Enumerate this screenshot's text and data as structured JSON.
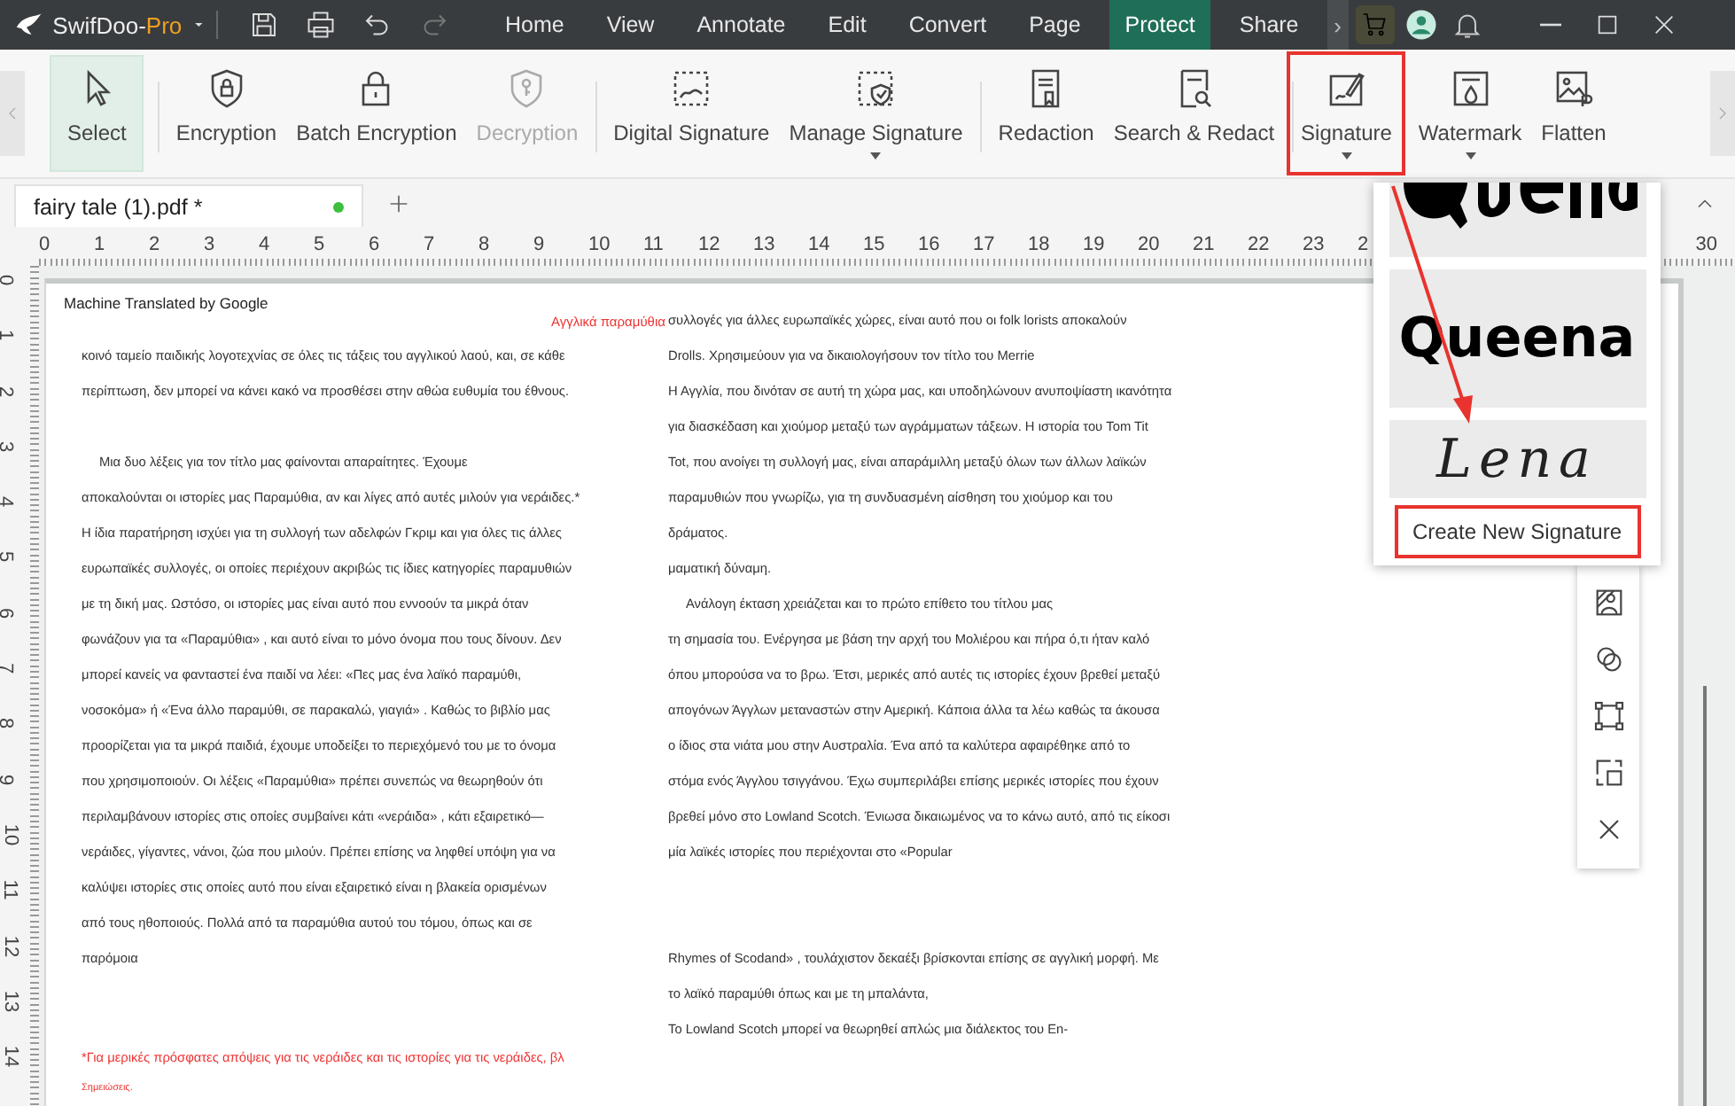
{
  "app": {
    "name": "SwifDoo-",
    "edition": "Pro"
  },
  "quick_actions": [
    {
      "kind": "save",
      "disabled": false
    },
    {
      "kind": "print",
      "disabled": false
    },
    {
      "kind": "undo",
      "disabled": false
    },
    {
      "kind": "redo",
      "disabled": true
    }
  ],
  "menu": [
    {
      "label": "Home",
      "selected": false
    },
    {
      "label": "View",
      "selected": false
    },
    {
      "label": "Annotate",
      "selected": false
    },
    {
      "label": "Edit",
      "selected": false
    },
    {
      "label": "Convert",
      "selected": false
    },
    {
      "label": "Page",
      "selected": false
    },
    {
      "label": "Protect",
      "selected": true
    },
    {
      "label": "Share",
      "selected": false
    }
  ],
  "menu_more": "›",
  "toolbar": [
    {
      "label": "Select",
      "selected": true,
      "disabled": false,
      "dropdown": false,
      "highlighted": false,
      "group_start": false
    },
    {
      "label": "Encryption",
      "selected": false,
      "disabled": false,
      "dropdown": false,
      "highlighted": false,
      "group_start": true
    },
    {
      "label": "Batch Encryption",
      "selected": false,
      "disabled": false,
      "dropdown": false,
      "highlighted": false,
      "group_start": false
    },
    {
      "label": "Decryption",
      "selected": false,
      "disabled": true,
      "dropdown": false,
      "highlighted": false,
      "group_start": false
    },
    {
      "label": "Digital Signature",
      "selected": false,
      "disabled": false,
      "dropdown": false,
      "highlighted": false,
      "group_start": true
    },
    {
      "label": "Manage Signature",
      "selected": false,
      "disabled": false,
      "dropdown": true,
      "highlighted": false,
      "group_start": false
    },
    {
      "label": "Redaction",
      "selected": false,
      "disabled": false,
      "dropdown": false,
      "highlighted": false,
      "group_start": true
    },
    {
      "label": "Search & Redact",
      "selected": false,
      "disabled": false,
      "dropdown": false,
      "highlighted": false,
      "group_start": false
    },
    {
      "label": "Signature",
      "selected": false,
      "disabled": false,
      "dropdown": true,
      "highlighted": true,
      "group_start": true
    },
    {
      "label": "Watermark",
      "selected": false,
      "disabled": false,
      "dropdown": true,
      "highlighted": false,
      "group_start": false
    },
    {
      "label": "Flatten",
      "selected": false,
      "disabled": false,
      "dropdown": false,
      "highlighted": false,
      "group_start": false
    }
  ],
  "tabs": [
    {
      "label": "fairy tale (1).pdf *",
      "selected": true,
      "modified": true
    }
  ],
  "ruler": {
    "labels": [
      "0",
      "1",
      "2",
      "3",
      "4",
      "5",
      "6",
      "7",
      "8",
      "9",
      "10",
      "11",
      "12",
      "13",
      "14",
      "15",
      "16",
      "17",
      "18",
      "19",
      "20",
      "21",
      "22",
      "23",
      "2"
    ],
    "end_label": "30",
    "vertical_labels": [
      "0",
      "1",
      "2",
      "3",
      "4",
      "5",
      "6",
      "7",
      "8",
      "9",
      "10",
      "11",
      "12",
      "13",
      "14"
    ]
  },
  "document": {
    "header": "Machine Translated by Google",
    "title": "Αγγλικά παραμύθια",
    "columns": [
      {
        "lines": [
          {
            "kind": "text",
            "space_before": false,
            "indent": false,
            "text": "κοινό ταμείο παιδικής λογοτεχνίας σε όλες τις τάξεις του αγγλικού λαού, και, σε κάθε"
          },
          {
            "kind": "text",
            "space_before": false,
            "indent": false,
            "text": "περίπτωση, δεν μπορεί να κάνει κακό να προσθέσει στην αθώα ευθυμία του έθνους."
          },
          {
            "kind": "text",
            "space_before": true,
            "indent": true,
            "text": "Μια δυο λέξεις για τον τίτλο μας φαίνονται απαραίτητες. Έχουμε"
          },
          {
            "kind": "text",
            "space_before": false,
            "indent": false,
            "text": "αποκαλούνται οι ιστορίες μας Παραμύθια, αν και λίγες από αυτές μιλούν για νεράιδες.*"
          },
          {
            "kind": "text",
            "space_before": false,
            "indent": false,
            "text": "Η ίδια παρατήρηση ισχύει για τη συλλογή των αδελφών Γκριμ και για όλες τις άλλες"
          },
          {
            "kind": "text",
            "space_before": false,
            "indent": false,
            "text": "ευρωπαϊκές συλλογές, οι οποίες περιέχουν ακριβώς τις ίδιες κατηγορίες παραμυθιών"
          },
          {
            "kind": "text",
            "space_before": false,
            "indent": false,
            "text": "με τη δική μας. Ωστόσο, οι ιστορίες μας είναι αυτό που εννοούν τα μικρά όταν"
          },
          {
            "kind": "text",
            "space_before": false,
            "indent": false,
            "text": "φωνάζουν για τα «Παραμύθια» , και αυτό είναι το μόνο όνομα που τους δίνουν. Δεν"
          },
          {
            "kind": "text",
            "space_before": false,
            "indent": false,
            "text": "μπορεί κανείς να φανταστεί ένα παιδί να λέει: «Πες μας ένα λαϊκό παραμύθι,"
          },
          {
            "kind": "text",
            "space_before": false,
            "indent": false,
            "text": "νοσοκόμα» ή «Ένα άλλο παραμύθι, σε παρακαλώ, γιαγιά» . Καθώς το βιβλίο μας"
          },
          {
            "kind": "text",
            "space_before": false,
            "indent": false,
            "text": "προορίζεται για τα μικρά παιδιά, έχουμε υποδείξει το περιεχόμενό του με το όνομα"
          },
          {
            "kind": "text",
            "space_before": false,
            "indent": false,
            "text": "που χρησιμοποιούν. Οι λέξεις «Παραμύθια» πρέπει συνεπώς να θεωρηθούν ότι"
          },
          {
            "kind": "text",
            "space_before": false,
            "indent": false,
            "text": "περιλαμβάνουν ιστορίες στις οποίες συμβαίνει κάτι «νεράιδα» , κάτι εξαιρετικό—"
          },
          {
            "kind": "text",
            "space_before": false,
            "indent": false,
            "text": "νεράιδες, γίγαντες, νάνοι, ζώα που μιλούν. Πρέπει επίσης να ληφθεί υπόψη για να"
          },
          {
            "kind": "text",
            "space_before": false,
            "indent": false,
            "text": "καλύψει ιστορίες στις οποίες αυτό που είναι εξαιρετικό είναι η βλακεία ορισμένων"
          },
          {
            "kind": "text",
            "space_before": false,
            "indent": false,
            "text": "από τους ηθοποιούς. Πολλά από τα παραμύθια αυτού του τόμου, όπως και σε"
          },
          {
            "kind": "text",
            "space_before": false,
            "indent": false,
            "text": "παρόμοια"
          },
          {
            "kind": "footnote",
            "space_before": true,
            "indent": false,
            "text": "*Για μερικές πρόσφατες απόψεις για τις νεράιδες και τις ιστορίες για τις νεράιδες, βλ"
          },
          {
            "kind": "note",
            "space_before": false,
            "indent": false,
            "text": "Σημειώσεις."
          }
        ]
      },
      {
        "lines": [
          {
            "kind": "text",
            "space_before": false,
            "indent": false,
            "text": "συλλογές για άλλες ευρωπαϊκές χώρες, είναι αυτό που οι folk lorists αποκαλούν"
          },
          {
            "kind": "text",
            "space_before": false,
            "indent": false,
            "text": "Drolls. Χρησιμεύουν για να δικαιολογήσουν τον τίτλο του Merrie"
          },
          {
            "kind": "text",
            "space_before": false,
            "indent": false,
            "text": "Η Αγγλία, που δινόταν σε αυτή τη χώρα μας, και υποδηλώνουν ανυποψίαστη ικανότητα"
          },
          {
            "kind": "text",
            "space_before": false,
            "indent": false,
            "text": "για διασκέδαση και χιούμορ μεταξύ των αγράμματων τάξεων. Η ιστορία του Tom Tit"
          },
          {
            "kind": "text",
            "space_before": false,
            "indent": false,
            "text": "Tot, που ανοίγει τη συλλογή μας, είναι απαράμιλλη μεταξύ όλων των άλλων λαϊκών"
          },
          {
            "kind": "text",
            "space_before": false,
            "indent": false,
            "text": "παραμυθιών που γνωρίζω, για τη συνδυασμένη αίσθηση του χιούμορ και του"
          },
          {
            "kind": "text",
            "space_before": false,
            "indent": false,
            "text": "δράματος."
          },
          {
            "kind": "text",
            "space_before": false,
            "indent": false,
            "text": "μαματική δύναμη."
          },
          {
            "kind": "text",
            "space_before": false,
            "indent": true,
            "text": "Ανάλογη έκταση χρειάζεται και το πρώτο επίθετο του τίτλου μας"
          },
          {
            "kind": "text",
            "space_before": false,
            "indent": false,
            "text": "τη σημασία του. Ενέργησα με βάση την αρχή του Μολιέρου και πήρα ό,τι ήταν καλό"
          },
          {
            "kind": "text",
            "space_before": false,
            "indent": false,
            "text": "όπου μπορούσα να το βρω. Έτσι, μερικές από αυτές τις ιστορίες έχουν βρεθεί μεταξύ"
          },
          {
            "kind": "text",
            "space_before": false,
            "indent": false,
            "text": "απογόνων Άγγλων μεταναστών στην Αμερική. Κάποια άλλα τα λέω καθώς τα άκουσα"
          },
          {
            "kind": "text",
            "space_before": false,
            "indent": false,
            "text": "ο ίδιος στα νιάτα μου στην Αυστραλία. Ένα από τα καλύτερα αφαιρέθηκε από το"
          },
          {
            "kind": "text",
            "space_before": false,
            "indent": false,
            "text": "στόμα ενός Άγγλου τσιγγάνου. Έχω συμπεριλάβει επίσης μερικές ιστορίες που έχουν"
          },
          {
            "kind": "text",
            "space_before": false,
            "indent": false,
            "text": "βρεθεί μόνο στο Lowland Scotch. Ένιωσα δικαιωμένος να το κάνω αυτό, από τις είκοσι"
          },
          {
            "kind": "text",
            "space_before": false,
            "indent": false,
            "text": "μία λαϊκές ιστορίες που περιέχονται στο «Popular"
          },
          {
            "kind": "text",
            "space_before": true,
            "indent": false,
            "text": "Rhymes of Scodand» , τουλάχιστον δεκαέξι βρίσκονται επίσης σε αγγλική μορφή. Με"
          },
          {
            "kind": "text",
            "space_before": false,
            "indent": false,
            "text": "το λαϊκό παραμύθι όπως και με τη μπαλάντα,"
          },
          {
            "kind": "text",
            "space_before": false,
            "indent": false,
            "text": "Το Lowland Scotch μπορεί να θεωρηθεί απλώς μια διάλεκτος του En-"
          }
        ]
      }
    ]
  },
  "signature_menu": {
    "signatures": [
      {
        "kind": "cut"
      },
      {
        "kind": "bold",
        "text": "Queena"
      },
      {
        "kind": "script",
        "text": "Lena"
      }
    ],
    "create_button": {
      "label": "Create New Signature",
      "highlighted": true
    }
  }
}
